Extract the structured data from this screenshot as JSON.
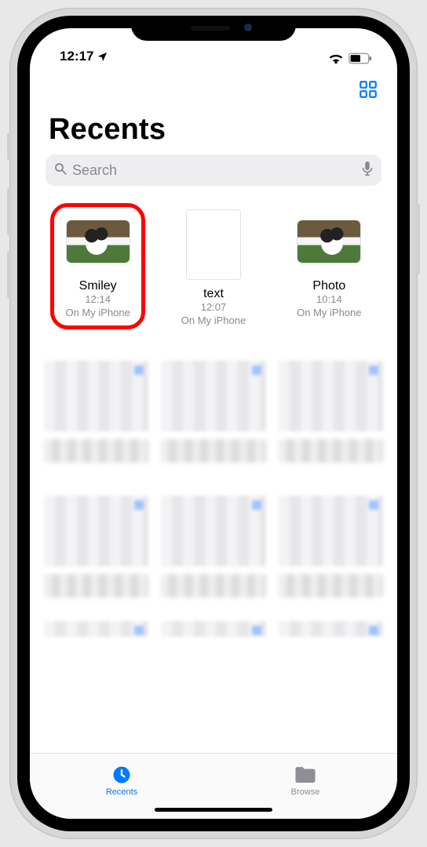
{
  "status": {
    "time": "12:17",
    "location_icon": "location-arrow",
    "wifi_icon": "wifi",
    "battery_icon": "battery-half"
  },
  "nav": {
    "view_toggle_icon": "grid-2x2"
  },
  "header": {
    "title": "Recents"
  },
  "search": {
    "placeholder": "Search",
    "value": "",
    "leading_icon": "magnifier",
    "trailing_icon": "microphone"
  },
  "files": [
    {
      "name": "Smiley",
      "time": "12:14",
      "location": "On My iPhone",
      "kind": "photo",
      "highlighted": true
    },
    {
      "name": "text",
      "time": "12:07",
      "location": "On My iPhone",
      "kind": "doc",
      "highlighted": false
    },
    {
      "name": "Photo",
      "time": "10:14",
      "location": "On My iPhone",
      "kind": "photo",
      "highlighted": false
    }
  ],
  "tabbar": {
    "items": [
      {
        "label": "Recents",
        "icon": "clock",
        "active": true
      },
      {
        "label": "Browse",
        "icon": "folder",
        "active": false
      }
    ]
  }
}
